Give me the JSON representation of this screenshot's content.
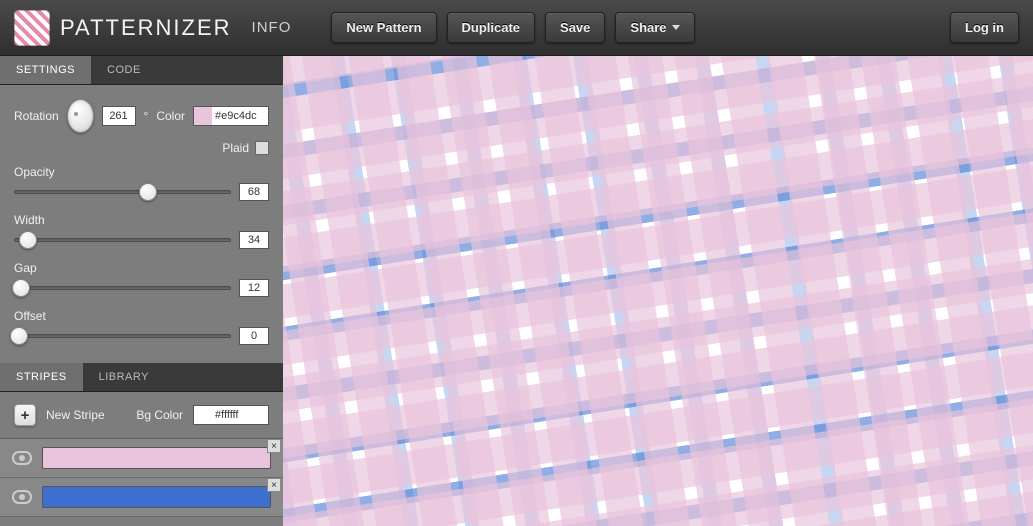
{
  "brand": "PATTERNIZER",
  "info_label": "INFO",
  "topbar": {
    "new_pattern": "New Pattern",
    "duplicate": "Duplicate",
    "save": "Save",
    "share": "Share",
    "login": "Log in"
  },
  "tabs": {
    "settings": "SETTINGS",
    "code": "CODE"
  },
  "settings": {
    "rotation_label": "Rotation",
    "rotation_value": "261",
    "degree_symbol": "°",
    "color_label": "Color",
    "color_hex": "#e9c4dc",
    "plaid_label": "Plaid",
    "plaid_checked": false,
    "opacity_label": "Opacity",
    "opacity_value": "68",
    "opacity_pct": 62,
    "width_label": "Width",
    "width_value": "34",
    "width_pct": 6,
    "gap_label": "Gap",
    "gap_value": "12",
    "gap_pct": 3,
    "offset_label": "Offset",
    "offset_value": "0",
    "offset_pct": 2
  },
  "tabs2": {
    "stripes": "STRIPES",
    "library": "LIBRARY"
  },
  "stripes_panel": {
    "new_stripe": "New Stripe",
    "bgcolor_label": "Bg Color",
    "bgcolor_hex": "#ffffff"
  },
  "stripes": [
    {
      "color": "#e9c4dc"
    },
    {
      "color": "#3d6fd1"
    }
  ]
}
